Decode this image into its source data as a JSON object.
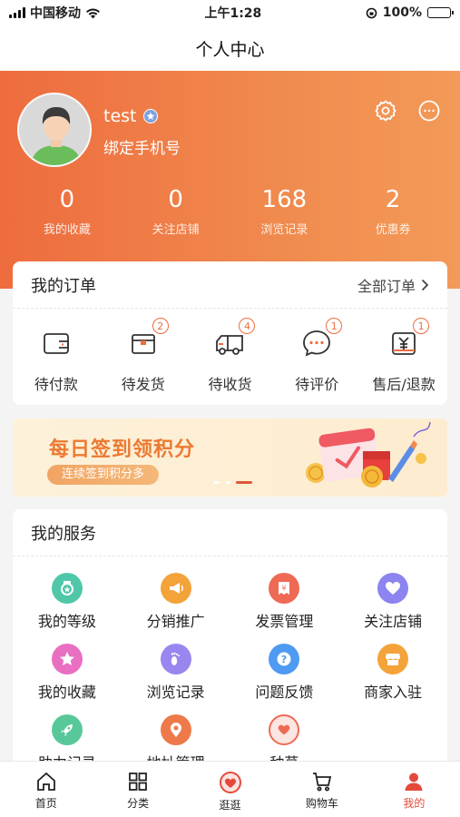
{
  "status_bar": {
    "carrier": "中国移动",
    "time": "上午1:28",
    "battery": "100%"
  },
  "header": {
    "title": "个人中心"
  },
  "profile": {
    "username": "test",
    "bind_phone": "绑定手机号",
    "stats": [
      {
        "value": "0",
        "label": "我的收藏"
      },
      {
        "value": "0",
        "label": "关注店铺"
      },
      {
        "value": "168",
        "label": "浏览记录"
      },
      {
        "value": "2",
        "label": "优惠券"
      }
    ]
  },
  "orders": {
    "title": "我的订单",
    "all_orders": "全部订单",
    "items": [
      {
        "label": "待付款",
        "icon": "wallet-icon",
        "badge": ""
      },
      {
        "label": "待发货",
        "icon": "package-icon",
        "badge": "2"
      },
      {
        "label": "待收货",
        "icon": "truck-icon",
        "badge": "4"
      },
      {
        "label": "待评价",
        "icon": "comment-icon",
        "badge": "1"
      },
      {
        "label": "售后/退款",
        "icon": "refund-icon",
        "badge": "1"
      }
    ]
  },
  "promo": {
    "title": "每日签到领积分",
    "subtitle": "连续签到积分多"
  },
  "services": {
    "title": "我的服务",
    "items": [
      {
        "label": "我的等级",
        "icon": "level-icon",
        "color": "#4fc7a8"
      },
      {
        "label": "分销推广",
        "icon": "megaphone-icon",
        "color": "#f3a33a"
      },
      {
        "label": "发票管理",
        "icon": "invoice-icon",
        "color": "#ee6a55"
      },
      {
        "label": "关注店铺",
        "icon": "heart-icon",
        "color": "#8c84f0"
      },
      {
        "label": "我的收藏",
        "icon": "star-icon",
        "color": "#e96fc2"
      },
      {
        "label": "浏览记录",
        "icon": "footprint-icon",
        "color": "#9a86ef"
      },
      {
        "label": "问题反馈",
        "icon": "question-icon",
        "color": "#4f9af2"
      },
      {
        "label": "商家入驻",
        "icon": "shop-icon",
        "color": "#f3a33a"
      },
      {
        "label": "助力记录",
        "icon": "rocket-icon",
        "color": "#58c89a"
      },
      {
        "label": "地址管理",
        "icon": "location-icon",
        "color": "#ee7a4a"
      },
      {
        "label": "种草",
        "icon": "heart-chat-icon",
        "color": "#ee6a55"
      }
    ]
  },
  "tabbar": {
    "items": [
      {
        "label": "首页",
        "icon": "home-icon"
      },
      {
        "label": "分类",
        "icon": "grid-icon"
      },
      {
        "label": "逛逛",
        "icon": "heart-bubble-icon"
      },
      {
        "label": "购物车",
        "icon": "cart-icon"
      },
      {
        "label": "我的",
        "icon": "person-icon"
      }
    ],
    "active_color": "#e34a3a"
  },
  "colors": {
    "accent": "#ee6c3e",
    "banner_gradient_start": "#ee6c3e",
    "banner_gradient_end": "#f39a58"
  }
}
